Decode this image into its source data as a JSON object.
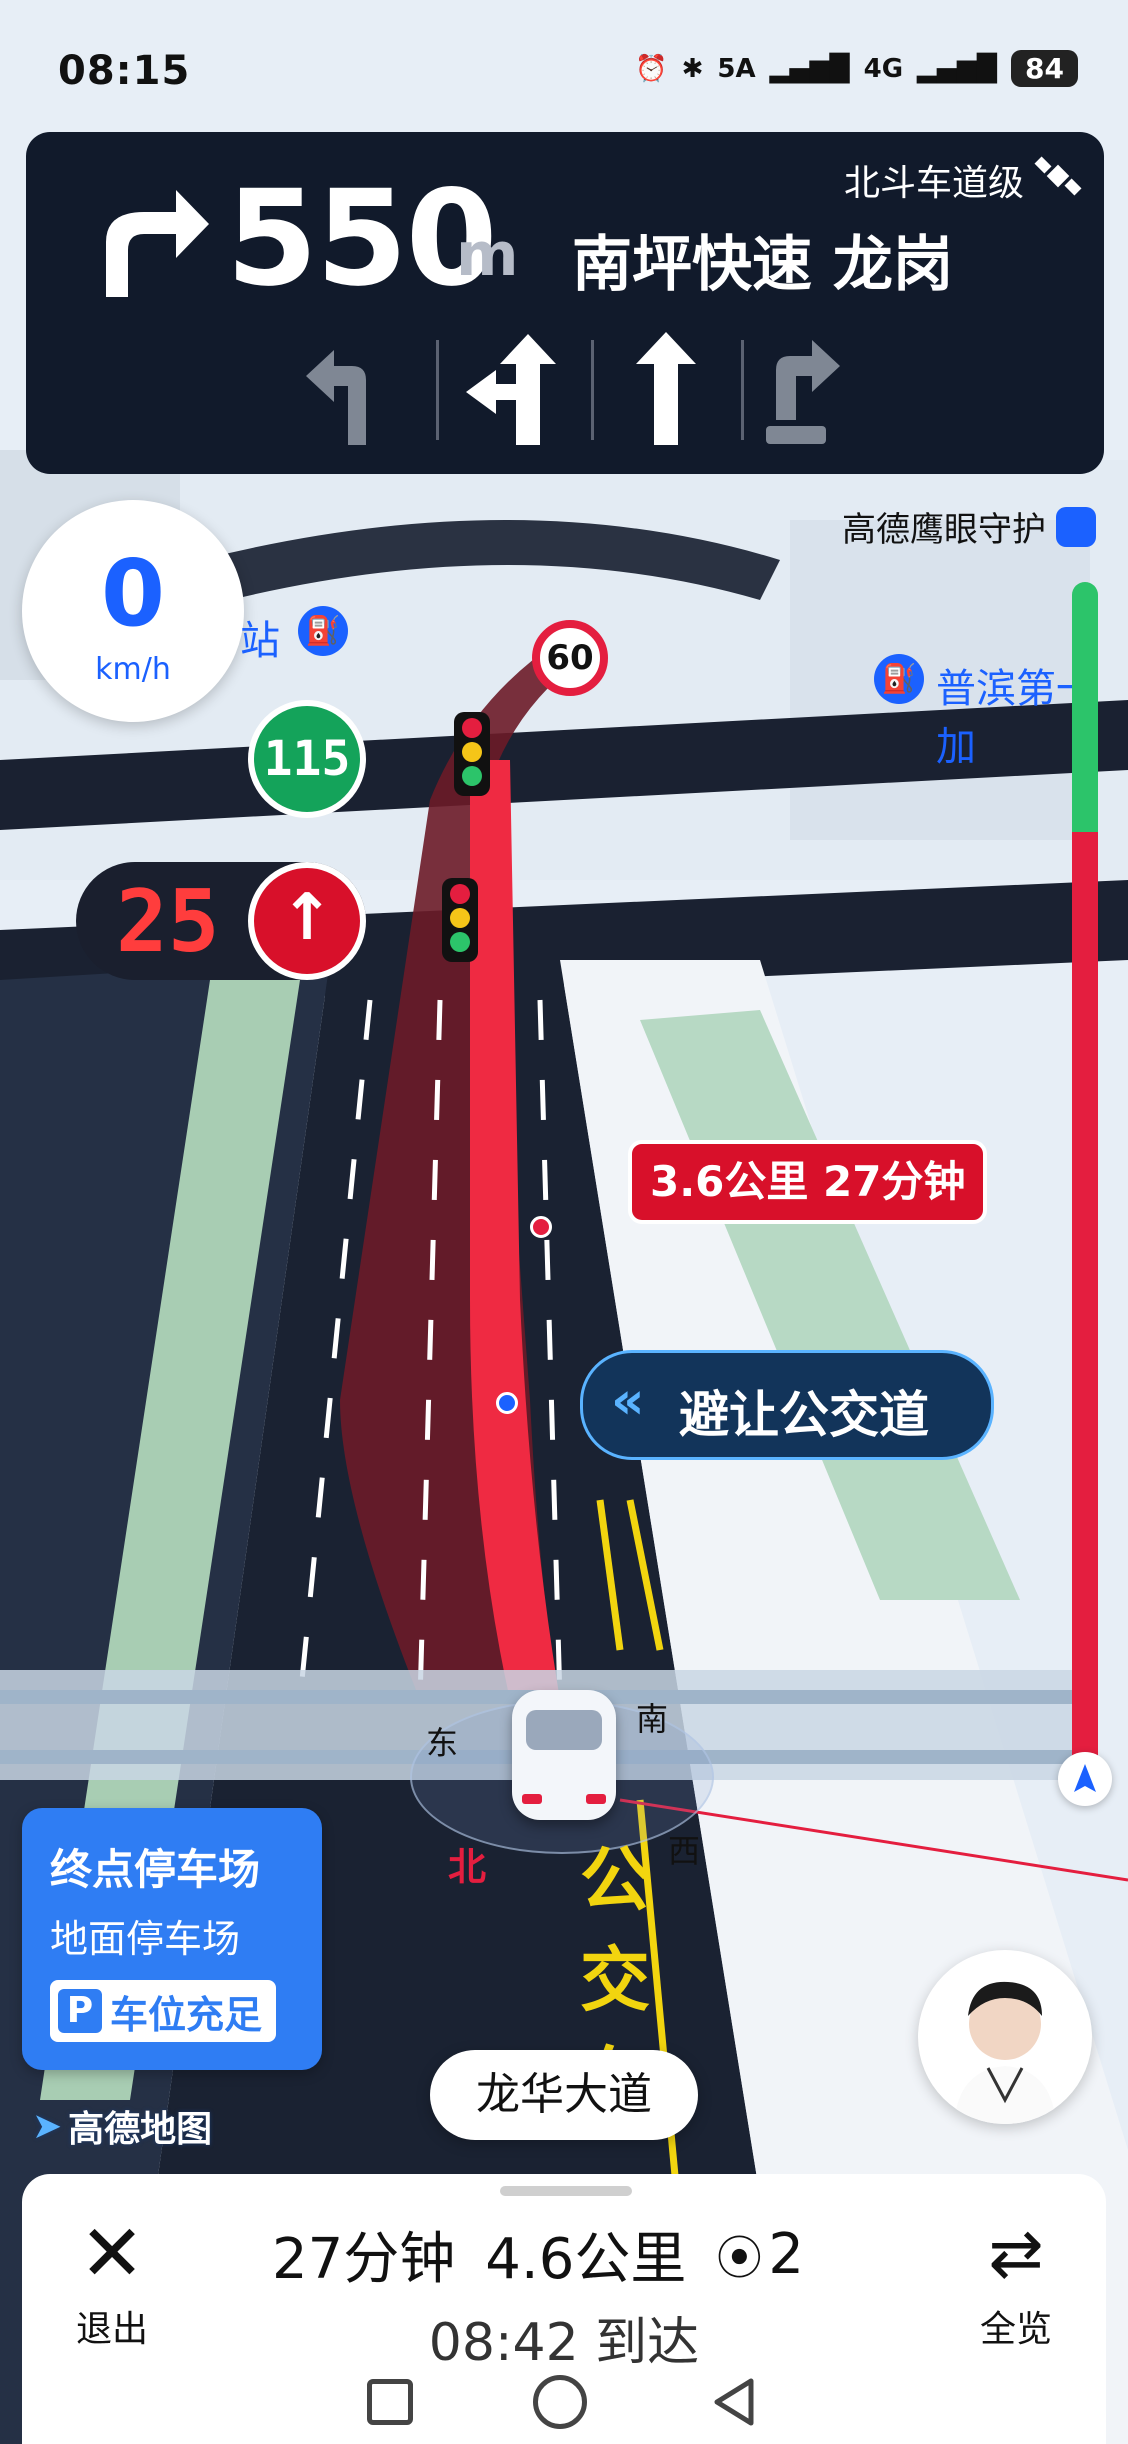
{
  "status_bar": {
    "time": "08:15",
    "battery": "84",
    "network_labels": [
      "5A",
      "4G"
    ]
  },
  "guidance": {
    "distance": "550",
    "unit": "m",
    "road": "南坪快速 龙岗",
    "beidou_label": "北斗车道级",
    "lanes": [
      "left-turn",
      "left-straight",
      "straight",
      "bus-lane-right-turn"
    ]
  },
  "speed": {
    "value": "0",
    "unit": "km/h"
  },
  "map": {
    "station_label": "站",
    "poi_label": "普滨第一加",
    "speed_limit": "60",
    "signal_countdown_green": "115",
    "signal_countdown_red": "25",
    "eagle_eye": "高德鹰眼守护",
    "traffic_callout": "3.6公里 27分钟",
    "bus_lane_callout": "避让公交道",
    "compass": {
      "east": "东",
      "south": "南",
      "west": "西",
      "north": "北"
    },
    "road_marking": "公交车"
  },
  "parking": {
    "title": "终点停车场",
    "subtitle": "地面停车场",
    "status": "车位充足",
    "p_icon": "P"
  },
  "logo": "高德地图",
  "street_name": "龙华大道",
  "bottom": {
    "exit_label": "退出",
    "overview_label": "全览",
    "time": "27分钟",
    "distance": "4.6公里",
    "lights": "2",
    "arrival": "08:42 到达"
  },
  "colors": {
    "route_red": "#e41e3f",
    "route_green": "#2cc46a",
    "accent_blue": "#1b61ff"
  }
}
